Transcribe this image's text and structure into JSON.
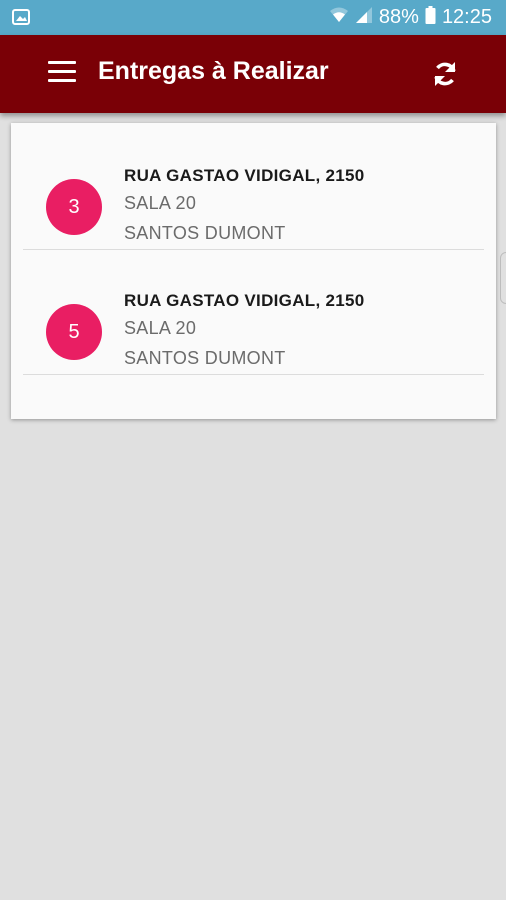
{
  "status_bar": {
    "battery": "88%",
    "time": "12:25",
    "icons": [
      "gallery-icon",
      "wifi-icon",
      "signal-icon",
      "battery-icon"
    ]
  },
  "app_bar": {
    "title": "Entregas à Realizar",
    "menu_icon": "menu-icon",
    "refresh_icon": "refresh-icon"
  },
  "deliveries": [
    {
      "number": "3",
      "address": "RUA GASTAO VIDIGAL, 2150",
      "complement": "SALA 20",
      "district": "SANTOS DUMONT"
    },
    {
      "number": "5",
      "address": "RUA GASTAO VIDIGAL, 2150",
      "complement": "SALA 20",
      "district": "SANTOS DUMONT"
    }
  ],
  "colors": {
    "status_bar": "#58a9c9",
    "app_bar": "#7a0006",
    "badge": "#e91e63",
    "background": "#e0e0e0"
  }
}
